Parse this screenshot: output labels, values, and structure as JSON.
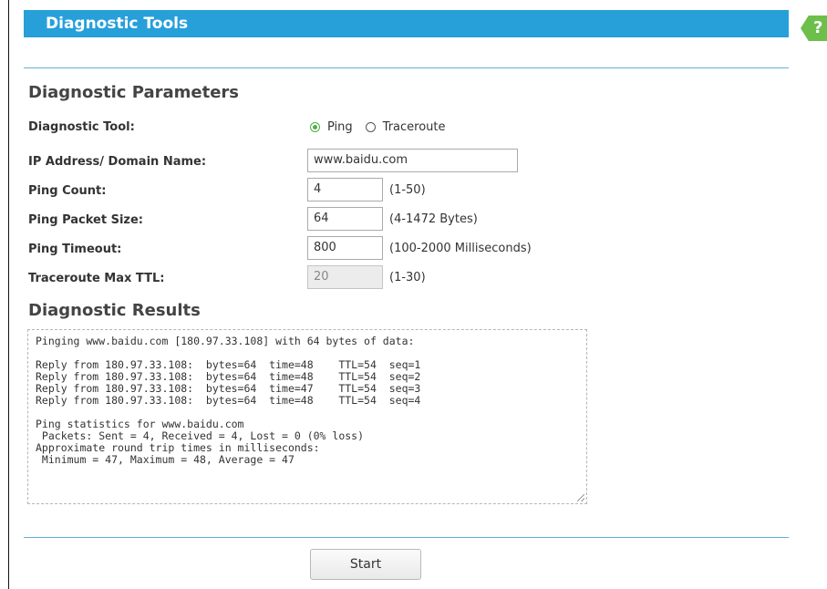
{
  "header": {
    "title": "Diagnostic Tools",
    "help_label": "?"
  },
  "parameters": {
    "title": "Diagnostic Parameters",
    "tool": {
      "label": "Diagnostic Tool:",
      "options": [
        "Ping",
        "Traceroute"
      ],
      "selected": "Ping"
    },
    "ip": {
      "label": "IP Address/ Domain Name:",
      "value": "www.baidu.com"
    },
    "ping_count": {
      "label": "Ping Count:",
      "value": "4",
      "hint": "(1-50)"
    },
    "packet_size": {
      "label": "Ping Packet Size:",
      "value": "64",
      "hint": "(4-1472 Bytes)"
    },
    "timeout": {
      "label": "Ping Timeout:",
      "value": "800",
      "hint": "(100-2000 Milliseconds)"
    },
    "max_ttl": {
      "label": "Traceroute Max TTL:",
      "value": "20",
      "hint": "(1-30)"
    }
  },
  "results": {
    "title": "Diagnostic Results",
    "lines": [
      "Pinging www.baidu.com [180.97.33.108] with 64 bytes of data:",
      "",
      "Reply from 180.97.33.108:  bytes=64  time=48    TTL=54  seq=1",
      "Reply from 180.97.33.108:  bytes=64  time=48    TTL=54  seq=2",
      "Reply from 180.97.33.108:  bytes=64  time=47    TTL=54  seq=3",
      "Reply from 180.97.33.108:  bytes=64  time=48    TTL=54  seq=4",
      "",
      "Ping statistics for www.baidu.com",
      " Packets: Sent = 4, Received = 4, Lost = 0 (0% loss)",
      "Approximate round trip times in milliseconds:",
      " Minimum = 47, Maximum = 48, Average = 47"
    ]
  },
  "actions": {
    "start_label": "Start"
  },
  "colors": {
    "header": "#27a0da",
    "help_tab": "#6cbf4a",
    "radio_accent": "#4fae42",
    "divider": "#5fb3d9"
  }
}
